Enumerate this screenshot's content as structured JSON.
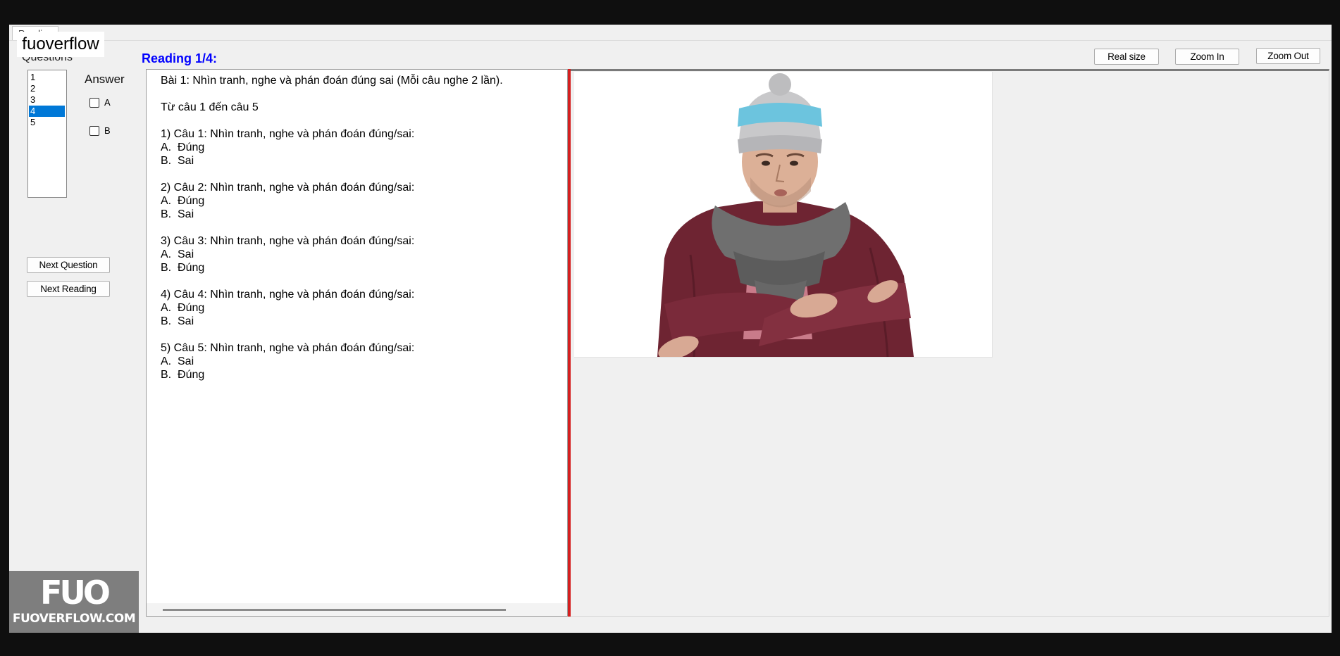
{
  "tab": {
    "label": "Reading"
  },
  "watermark": "fuoverflow",
  "questions": {
    "label": "Questions",
    "items": [
      "1",
      "2",
      "3",
      "4",
      "5"
    ],
    "selected": "4"
  },
  "answer": {
    "label": "Answer",
    "options": [
      {
        "label": "A",
        "checked": false
      },
      {
        "label": "B",
        "checked": false
      }
    ]
  },
  "buttons": {
    "next_question": "Next Question",
    "next_reading": "Next Reading",
    "real_size": "Real size",
    "zoom_in": "Zoom In",
    "zoom_out": "Zoom Out"
  },
  "reading": {
    "title": "Reading 1/4:",
    "text": "Bài 1: Nhìn tranh, nghe và phán đoán đúng sai (Mỗi câu nghe 2 lần).\n\nTừ câu 1 đến câu 5\n\n1) Câu 1: Nhìn tranh, nghe và phán đoán đúng/sai:\nA.  Đúng\nB.  Sai\n\n2) Câu 2: Nhìn tranh, nghe và phán đoán đúng/sai:\nA.  Đúng\nB.  Sai\n\n3) Câu 3: Nhìn tranh, nghe và phán đoán đúng/sai:\nA.  Sai\nB.  Đúng\n\n4) Câu 4: Nhìn tranh, nghe và phán đoán đúng/sai:\nA.  Đúng\nB.  Sai\n\n5) Câu 5: Nhìn tranh, nghe và phán đoán đúng/sai:\nA.  Sai\nB.  Đúng"
  },
  "logo": {
    "mark": "FUO",
    "site": "FUOVERFLOW.COM"
  },
  "colors": {
    "accent": "#0000ff",
    "selection": "#0078d7",
    "divider": "#d51f1f"
  }
}
